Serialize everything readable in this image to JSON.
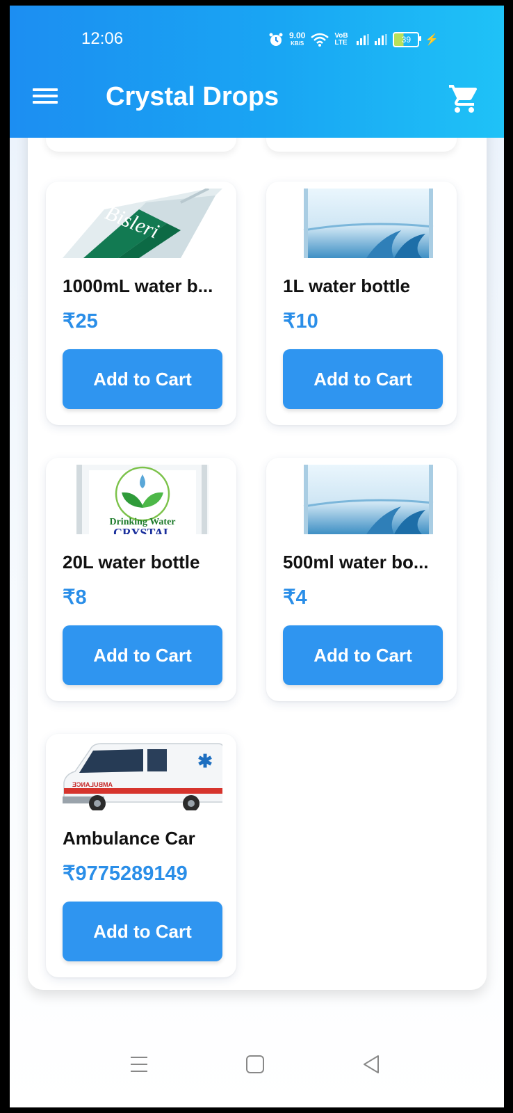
{
  "status": {
    "time": "12:06",
    "speed": "9.00",
    "speed_unit": "KB/S",
    "volte": "VoB LTE",
    "battery": "39"
  },
  "app": {
    "title": "Crystal Drops"
  },
  "products": [
    {
      "name": "1000mL water b...",
      "price": "₹25",
      "button": "Add to Cart",
      "image": "bisleri-bottle-image"
    },
    {
      "name": "1L water bottle",
      "price": "₹10",
      "button": "Add to Cart",
      "image": "water-bottle-image"
    },
    {
      "name": "20L water bottle",
      "price": "₹8",
      "button": "Add to Cart",
      "image": "drinking-water-crystal-image"
    },
    {
      "name": "500ml water bo...",
      "price": "₹4",
      "button": "Add to Cart",
      "image": "water-bottle-image"
    },
    {
      "name": "Ambulance Car",
      "price": "₹9775289149",
      "button": "Add to Cart",
      "image": "ambulance-image"
    }
  ],
  "image_text": {
    "bisleri": "Bisleri",
    "drinking": "Drinking Water",
    "crystal": "CRYSTAL",
    "ambulance": "AMBULANCE"
  },
  "colors": {
    "appbar_start": "#1c8ef2",
    "appbar_end": "#1fc2f7",
    "button": "#2f95f0",
    "price": "#2a8ee8"
  }
}
